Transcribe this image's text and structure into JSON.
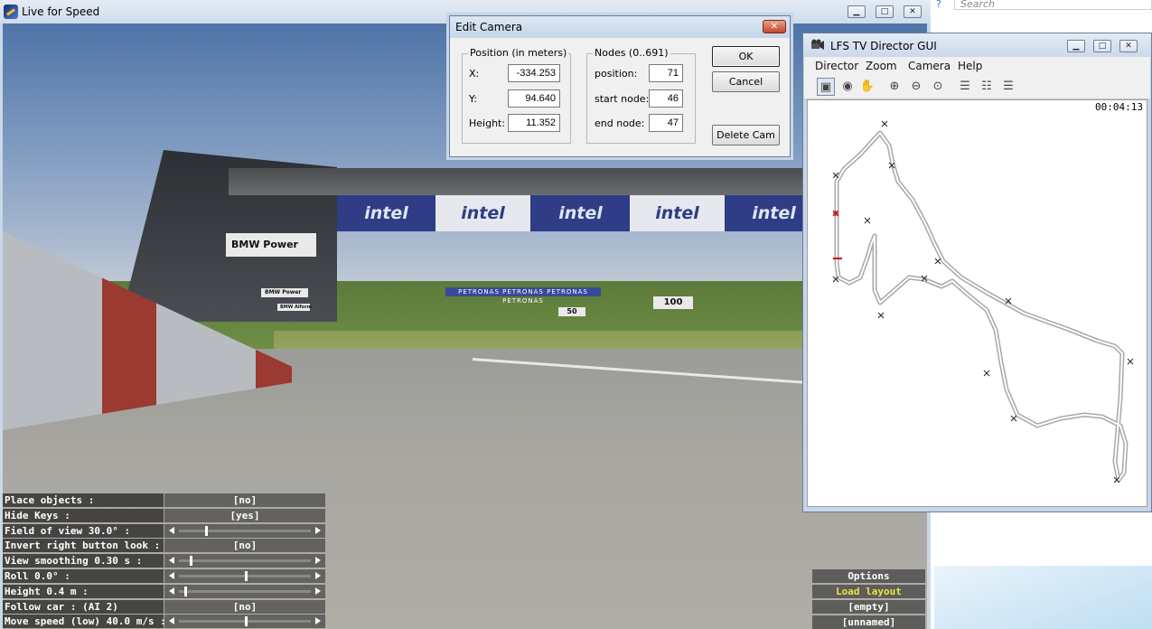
{
  "background": {
    "search_placeholder": "Search"
  },
  "lfs_window": {
    "title": "Live for Speed",
    "scene": {
      "bmw_sign": "BMW Power",
      "bmw_sign_small": "BMW Power",
      "bmw_sign_small2": "BMW Alform",
      "intel_banners": [
        "intel",
        "intel",
        "intel",
        "intel",
        "intel"
      ],
      "far_banner": "PETRONAS  PETRONAS  PETRONAS  PETRONAS",
      "distance_markers": [
        "100",
        "50"
      ]
    },
    "options": [
      {
        "label": "Place objects :",
        "type": "value",
        "value": "[no]"
      },
      {
        "label": "Hide Keys :",
        "type": "value",
        "value": "[yes]"
      },
      {
        "label": "Field of view 30.0° :",
        "type": "slider",
        "level": 0.2
      },
      {
        "label": "Invert right button look :",
        "type": "value",
        "value": "[no]"
      },
      {
        "label": "View smoothing 0.30 s :",
        "type": "slider",
        "level": 0.08
      },
      {
        "label": "Roll 0.0° :",
        "type": "slider",
        "level": 0.5
      },
      {
        "label": "Height 0.4 m :",
        "type": "slider",
        "level": 0.04
      },
      {
        "label": "Follow car : (AI 2)",
        "type": "value",
        "value": "[no]"
      },
      {
        "label": "Move speed (low) 40.0 m/s :",
        "type": "slider",
        "level": 0.5
      }
    ],
    "right_buttons": [
      "Options",
      "Load layout",
      "[empty]",
      "[unnamed]"
    ]
  },
  "edit_camera": {
    "title": "Edit Camera",
    "position_group": "Position (in meters)",
    "x_label": "X:",
    "x_value": "-334.253",
    "y_label": "Y:",
    "y_value": "94.640",
    "height_label": "Height:",
    "height_value": "11.352",
    "nodes_group": "Nodes (0..691)",
    "position_label": "position:",
    "position_value": "71",
    "start_node_label": "start node:",
    "start_node_value": "46",
    "end_node_label": "end node:",
    "end_node_value": "47",
    "ok_label": "OK",
    "cancel_label": "Cancel",
    "delete_label": "Delete Cam"
  },
  "director": {
    "title": "LFS TV Director GUI",
    "menu": [
      "Director",
      "Zoom",
      "Camera",
      "Help"
    ],
    "toolbar_icons": [
      "monitor-icon",
      "camera-icon",
      "hand-icon",
      "zoom-in-icon",
      "zoom-out-icon",
      "zoom-fit-icon",
      "layout-icon-1",
      "layout-icon-2",
      "layout-icon-3"
    ],
    "timer": "00:04:13",
    "accent": "#ff0000"
  }
}
